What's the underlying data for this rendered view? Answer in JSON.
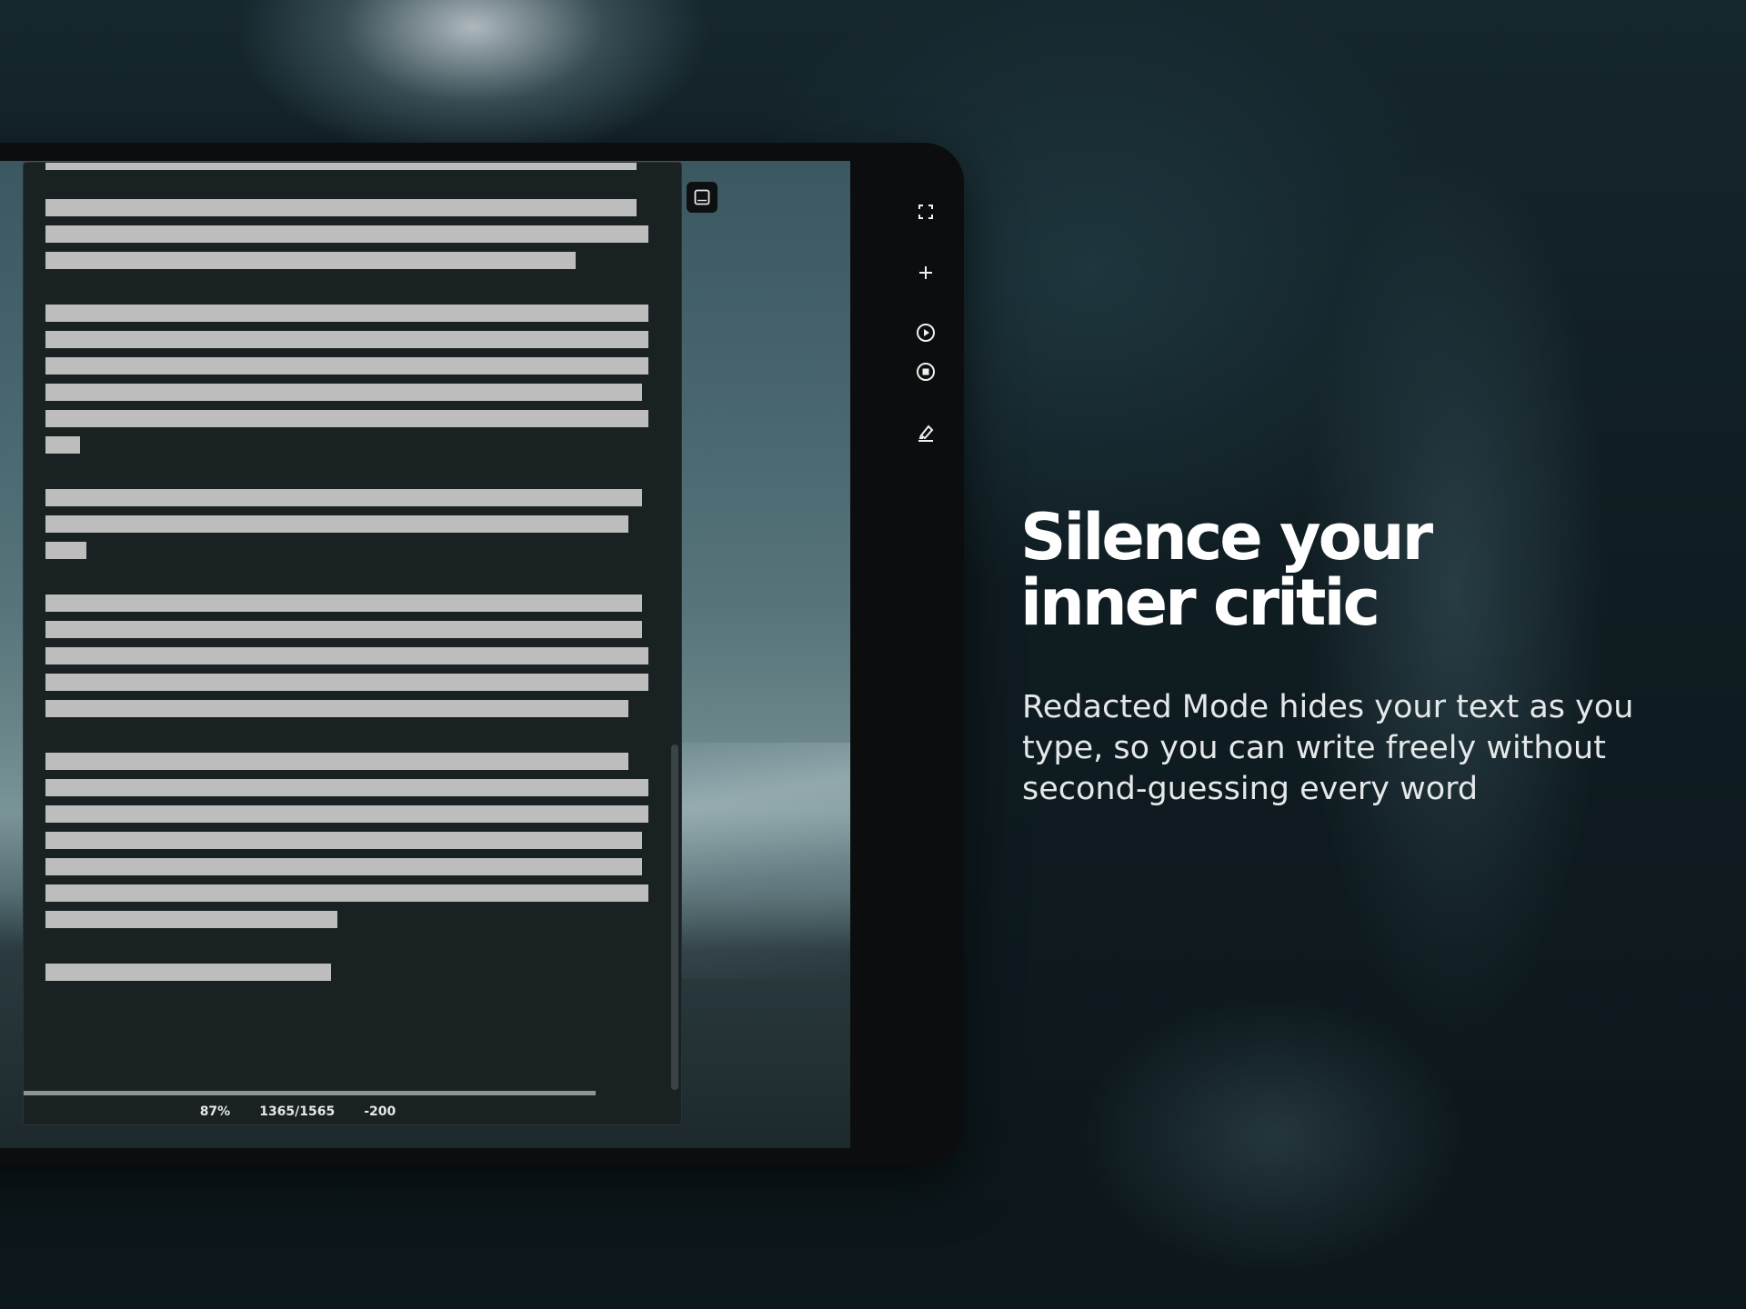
{
  "editor": {
    "stats": {
      "percent": "87%",
      "word_count": "1365/1565",
      "remaining": "-200"
    },
    "progress": 0.87
  },
  "toolbar": {
    "items": [
      {
        "icon": "fullscreen-icon"
      },
      {
        "icon": "plus-icon"
      },
      {
        "icon": "play-icon"
      },
      {
        "icon": "stop-icon"
      },
      {
        "icon": "highlighter-icon"
      }
    ]
  },
  "promo": {
    "headline": "Silence your inner critic",
    "subtitle": "Redacted Mode hides your text as you type, so you can write freely without second-guessing every word"
  },
  "colors": {
    "redaction": "#bdbdbd",
    "editor_bg": "#1a2123",
    "frame": "#0b0d0e"
  }
}
